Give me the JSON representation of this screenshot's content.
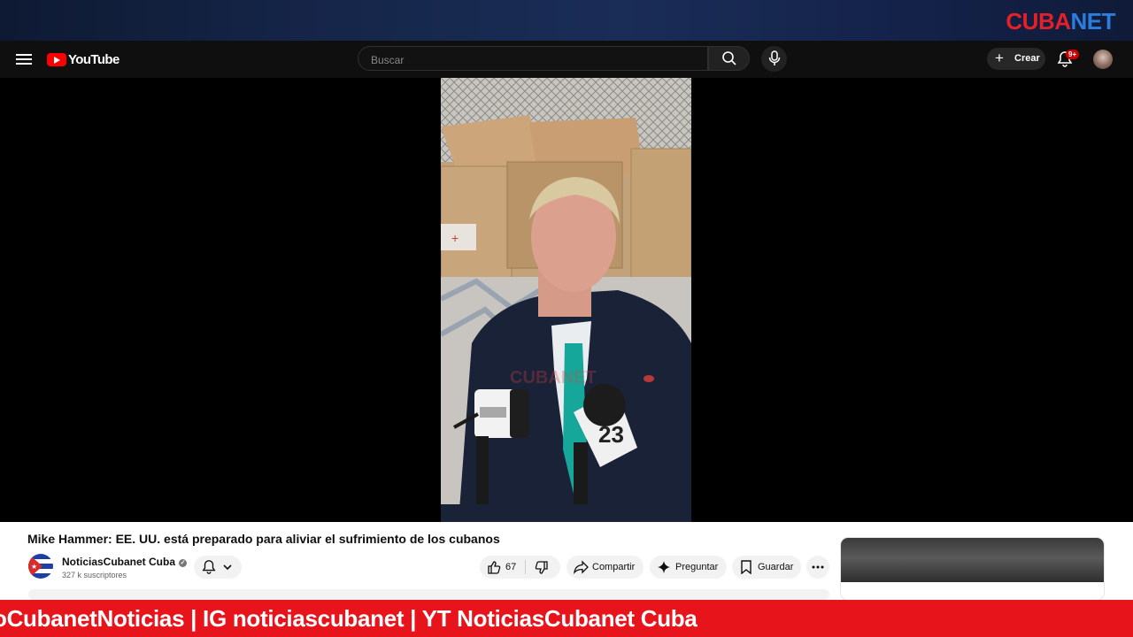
{
  "overlay": {
    "brand_part1": "CUBA",
    "brand_part2": "NET"
  },
  "youtube": {
    "logo_text": "YouTube",
    "search_placeholder": "Buscar",
    "create_label": "Crear",
    "notification_badge": "9+"
  },
  "video": {
    "watermark": "CUBANET",
    "mic_number": "23",
    "title": "Mike Hammer: EE. UU. está preparado para aliviar el sufrimiento de los cubanos"
  },
  "channel": {
    "name": "NoticiasCubanet Cuba",
    "subscribers": "327 k suscriptores"
  },
  "actions": {
    "like_count": "67",
    "share_label": "Compartir",
    "ask_label": "Preguntar",
    "save_label": "Guardar"
  },
  "ticker": {
    "text": "oCubanetNoticias | IG noticiascubanet | YT NoticiasCubanet Cuba"
  },
  "icons": [
    "menu-icon",
    "youtube-play-icon",
    "search-icon",
    "microphone-icon",
    "plus-icon",
    "bell-icon",
    "avatar",
    "subscribe-bell-icon",
    "chevron-down-icon",
    "like-icon",
    "dislike-icon",
    "share-icon",
    "sparkle-icon",
    "save-icon",
    "more-icon"
  ],
  "colors": {
    "brand_red": "#e4202a",
    "brand_blue": "#2b7de0",
    "ticker_red": "#e8141c",
    "youtube_red": "#ff0000"
  }
}
